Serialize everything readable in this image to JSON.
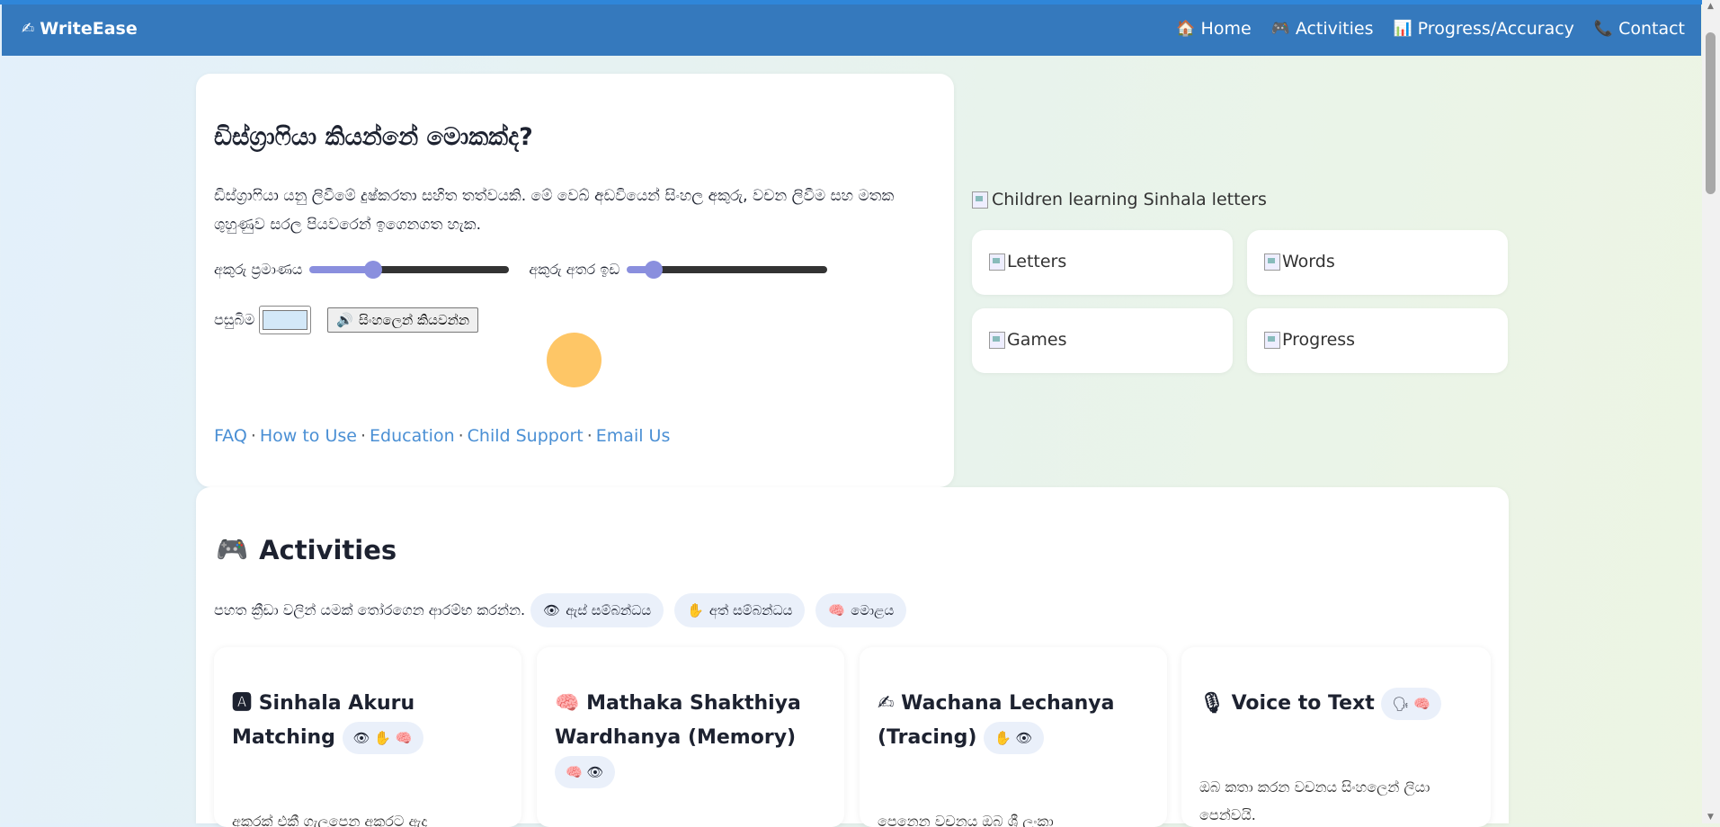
{
  "navbar": {
    "brand": "WriteEase",
    "brand_icon": "✍",
    "links": [
      {
        "icon": "🏠",
        "label": "Home"
      },
      {
        "icon": "🎮",
        "label": "Activities"
      },
      {
        "icon": "📊",
        "label": "Progress/Accuracy"
      },
      {
        "icon": "📞",
        "label": "Contact"
      }
    ]
  },
  "hero": {
    "title": "ඩිස්ග්‍රාෆියා කියන්නේ මොකක්ද?",
    "text": "ඩිස්ග්‍රාෆියා යනු ලිවීමේ දුෂ්කරතා සහිත තත්වයකි. මේ වෙබ් අඩවියෙන් සිංහල අකුරු, වචන ලිවීම සහ මතක ශුහුණුව සරල පියවරෙන් ඉගෙනගත හැක.",
    "font_size_label": "අකුරු ප්‍රමාණය",
    "font_size_value": 30,
    "spacing_label": "අකුරු අතර ඉඩ",
    "spacing_value": 10,
    "background_label": "පසුබිම",
    "background_color": "#d3e8f8",
    "speak_icon": "🔊",
    "speak_label": "සිංහලෙන් කියවන්න",
    "footer_links": [
      "FAQ",
      "How to Use",
      "Education",
      "Child Support",
      "Email Us"
    ],
    "separator": "·"
  },
  "side": {
    "hero_image_alt": "Children learning Sinhala letters",
    "tiles": [
      "Letters",
      "Words",
      "Games",
      "Progress"
    ]
  },
  "activities": {
    "icon": "🎮",
    "title": "Activities",
    "subtitle": "පහත ක්‍රීඩා වලින් යමක් තෝරගෙන ආරම්භ කරන්න.",
    "filters": [
      {
        "icon": "👁",
        "label": "ඇස් සම්බන්ධය"
      },
      {
        "icon": "✋",
        "label": "අත් සම්බන්ධය"
      },
      {
        "icon": "🧠",
        "label": "මොළය"
      }
    ],
    "games": [
      {
        "icon": "🅰",
        "title": "Sinhala Akuru Matching",
        "chips": "👁 ✋ 🧠",
        "desc": "අකුරක් එකී ගැලපෙන අකුරට ඇද"
      },
      {
        "icon": "🧠",
        "title": "Mathaka Shakthiya Wardhanya (Memory)",
        "chips": "🧠 👁",
        "desc": ""
      },
      {
        "icon": "✍",
        "title": "Wachana Lechanya (Tracing)",
        "chips": "✋ 👁",
        "desc": "පෙනෙන වචනය ඔබ ශ්‍රී ලංකා"
      },
      {
        "icon": "🎙",
        "title": "Voice to Text",
        "chips": "🗣 🧠",
        "desc": "ඔබ කතා කරන වචනය සිංහලෙන් ලියා පෙන්වයි."
      }
    ]
  },
  "colors": {
    "navbar": "#3579bd",
    "accent_orange": "#fec666",
    "link": "#4a8fd4",
    "slider_thumb": "#8a8fde"
  }
}
